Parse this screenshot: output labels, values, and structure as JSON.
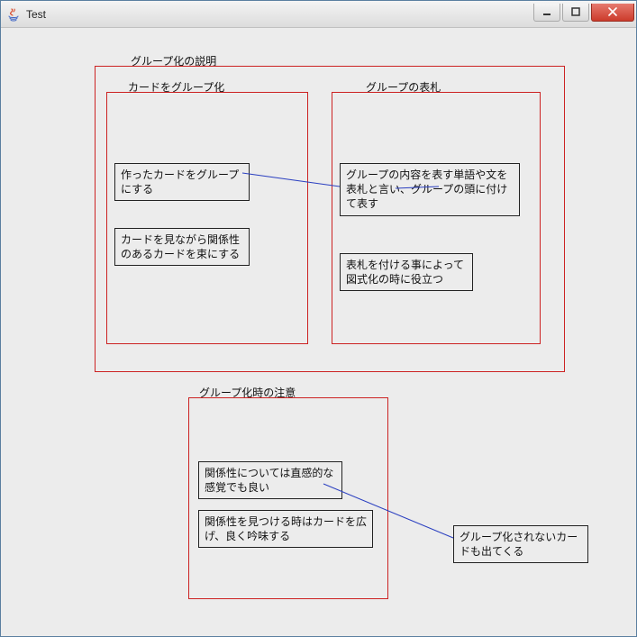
{
  "window": {
    "title": "Test"
  },
  "colors": {
    "group_border": "#cc2222",
    "card_border": "#222222",
    "line": "#2a3fc0"
  },
  "groups": {
    "outer": {
      "label": "グループ化の説明"
    },
    "left": {
      "label": "カードをグループ化"
    },
    "right": {
      "label": "グループの表札"
    },
    "bottom": {
      "label": "グループ化時の注意"
    }
  },
  "cards": {
    "a1": "作ったカードをグループにする",
    "a2": "カードを見ながら関係性のあるカードを束にする",
    "b1": "グループの内容を表す単語や文を表札と言い、グループの頭に付けて表す",
    "b2": "表札を付ける事によって図式化の時に役立つ",
    "c1": "関係性については直感的な感覚でも良い",
    "c2": "関係性を見つける時はカードを広げ、良く吟味する",
    "d1": "グループ化されないカードも出てくる"
  }
}
